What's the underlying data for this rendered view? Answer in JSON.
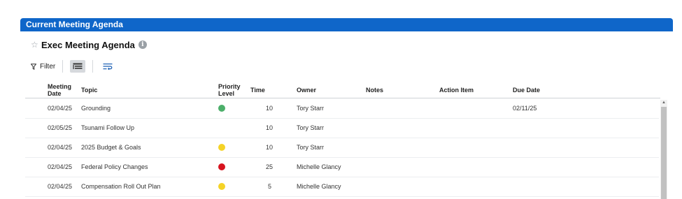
{
  "panel": {
    "title": "Current Meeting Agenda"
  },
  "sheet": {
    "title": "Exec Meeting Agenda",
    "favorite_icon": "star-outline-icon",
    "info_icon": "info-icon"
  },
  "toolbar": {
    "filter_label": "Filter"
  },
  "columns": {
    "meeting_date": [
      "Meeting",
      "Date"
    ],
    "topic": "Topic",
    "priority_level": [
      "Priority",
      "Level"
    ],
    "time": "Time",
    "owner": "Owner",
    "notes": "Notes",
    "action_item": "Action Item",
    "due_date": "Due Date"
  },
  "colors": {
    "green": "#4caf6a",
    "yellow": "#f5d327",
    "red": "#d7141f",
    "header_blue": "#0f66c9"
  },
  "rows": [
    {
      "date": "02/04/25",
      "topic": "Grounding",
      "priority": "green",
      "time": "10",
      "owner": "Tory Starr",
      "notes": "",
      "action_item": "",
      "due_date": "02/11/25"
    },
    {
      "date": "02/05/25",
      "topic": "Tsunami Follow Up",
      "priority": "",
      "time": "10",
      "owner": "Tory Starr",
      "notes": "",
      "action_item": "",
      "due_date": ""
    },
    {
      "date": "02/04/25",
      "topic": "2025 Budget & Goals",
      "priority": "yellow",
      "time": "10",
      "owner": "Tory Starr",
      "notes": "",
      "action_item": "",
      "due_date": ""
    },
    {
      "date": "02/04/25",
      "topic": "Federal Policy Changes",
      "priority": "red",
      "time": "25",
      "owner": "Michelle Glancy",
      "notes": "",
      "action_item": "",
      "due_date": ""
    },
    {
      "date": "02/04/25",
      "topic": "Compensation Roll Out Plan",
      "priority": "yellow",
      "time": "5",
      "owner": "Michelle Glancy",
      "notes": "",
      "action_item": "",
      "due_date": ""
    }
  ]
}
